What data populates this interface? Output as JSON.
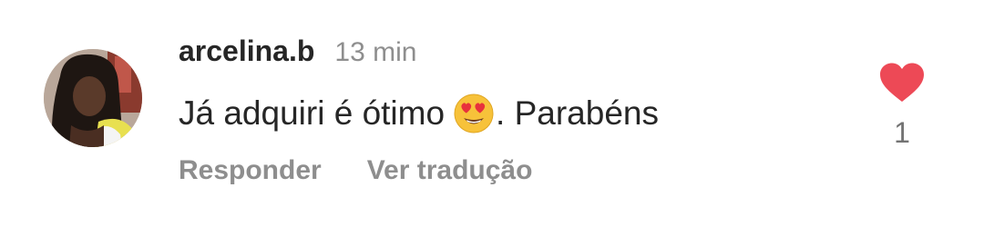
{
  "comment": {
    "username": "arcelina.b",
    "timestamp": "13 min",
    "text_before_emoji": "Já adquiri é ótimo",
    "emoji_icon": "heart-eyes-emoji-icon",
    "text_after_emoji": ". Parabéns",
    "actions": {
      "reply_label": "Responder",
      "translate_label": "Ver tradução"
    },
    "likes": {
      "count": "1",
      "liked": true,
      "icon": "heart-icon",
      "color": "#ed4956"
    }
  }
}
